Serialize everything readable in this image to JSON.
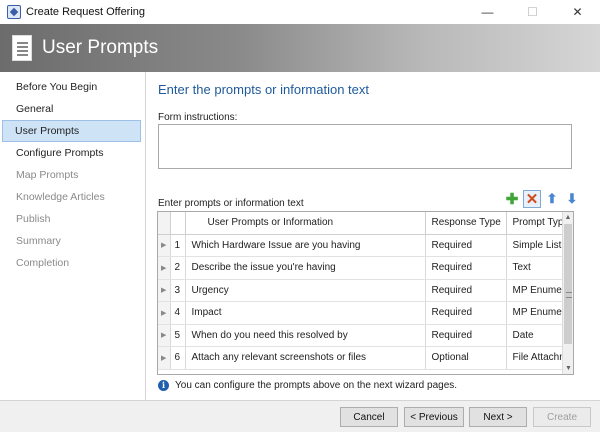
{
  "window": {
    "title": "Create Request Offering",
    "minimize": "—",
    "maximize": "☐",
    "close": "✕"
  },
  "banner": {
    "title": "User Prompts"
  },
  "nav": {
    "items": [
      {
        "label": "Before You Begin",
        "state": "normal"
      },
      {
        "label": "General",
        "state": "normal"
      },
      {
        "label": "User Prompts",
        "state": "active"
      },
      {
        "label": "Configure Prompts",
        "state": "normal"
      },
      {
        "label": "Map Prompts",
        "state": "muted"
      },
      {
        "label": "Knowledge Articles",
        "state": "muted"
      },
      {
        "label": "Publish",
        "state": "muted"
      },
      {
        "label": "Summary",
        "state": "muted"
      },
      {
        "label": "Completion",
        "state": "muted"
      }
    ]
  },
  "main": {
    "heading": "Enter the prompts or information text",
    "form_label": "Form instructions:",
    "form_value": "",
    "prompts_label": "Enter prompts or information text",
    "toolbar": {
      "add_icon": "add-icon",
      "delete_icon": "delete-icon",
      "up_icon": "move-up-icon",
      "down_icon": "move-down-icon"
    },
    "grid": {
      "columns": [
        "User Prompts or Information",
        "Response Type",
        "Prompt Type"
      ],
      "rows": [
        {
          "num": "1",
          "prompt": "Which Hardware Issue are you having",
          "response": "Required",
          "type": "Simple List"
        },
        {
          "num": "2",
          "prompt": "Describe the issue you're having",
          "response": "Required",
          "type": "Text"
        },
        {
          "num": "3",
          "prompt": "Urgency",
          "response": "Required",
          "type": "MP Enumerati..."
        },
        {
          "num": "4",
          "prompt": "Impact",
          "response": "Required",
          "type": "MP Enumerati..."
        },
        {
          "num": "5",
          "prompt": "When do you need this resolved by",
          "response": "Required",
          "type": "Date"
        },
        {
          "num": "6",
          "prompt": "Attach any relevant screenshots or files",
          "response": "Optional",
          "type": "File Attachment"
        }
      ]
    },
    "info_text": "You can configure the prompts above on the next wizard pages."
  },
  "footer": {
    "cancel": "Cancel",
    "previous": "< Previous",
    "next": "Next >",
    "create": "Create"
  }
}
